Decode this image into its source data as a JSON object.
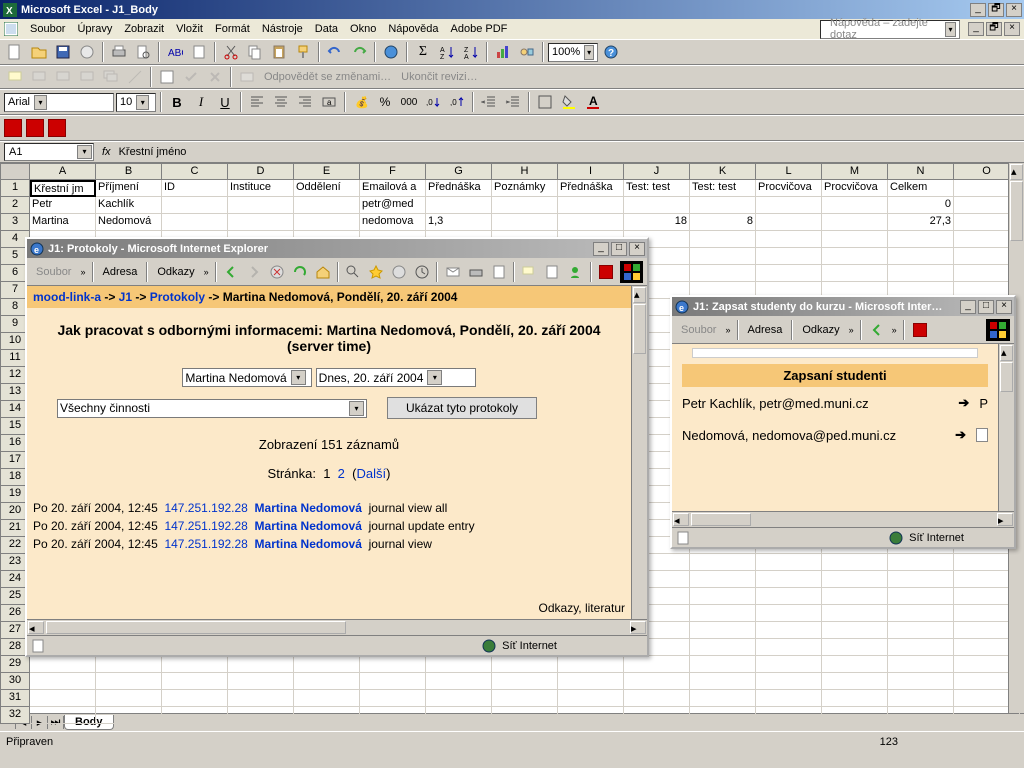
{
  "excel": {
    "app_title": "Microsoft Excel - J1_Body",
    "menus": [
      "Soubor",
      "Úpravy",
      "Zobrazit",
      "Vložit",
      "Formát",
      "Nástroje",
      "Data",
      "Okno",
      "Nápověda",
      "Adobe PDF"
    ],
    "help_placeholder": "Nápověda – zadejte dotaz",
    "track_changes_reply": "Odpovědět se změnami…",
    "track_changes_end": "Ukončit revizi…",
    "zoom": "100%",
    "font_name": "Arial",
    "font_size": "10",
    "name_box": "A1",
    "fx_label": "fx",
    "formula_value": "Křestní jméno",
    "columns": [
      "A",
      "B",
      "C",
      "D",
      "E",
      "F",
      "G",
      "H",
      "I",
      "J",
      "K",
      "L",
      "M",
      "N",
      "O"
    ],
    "rows": [
      "1",
      "2",
      "3",
      "4",
      "5",
      "6",
      "7",
      "8",
      "9",
      "10",
      "11",
      "12",
      "13",
      "14",
      "15",
      "16",
      "17",
      "18",
      "19",
      "20",
      "21",
      "22",
      "23",
      "24",
      "25",
      "26",
      "27",
      "28",
      "29",
      "30",
      "31",
      "32"
    ],
    "data": {
      "r1": [
        "Křestní jm",
        "Příjmení",
        "ID",
        "Instituce",
        "Oddělení",
        "Emailová a",
        "Přednáška",
        "Poznámky",
        "Přednáška",
        "Test: test",
        "Test: test",
        "Procvičova",
        "Procvičova",
        "Celkem",
        ""
      ],
      "r2": [
        "Petr",
        "Kachlík",
        "",
        "",
        "",
        "petr@med",
        "",
        "",
        "",
        "",
        "",
        "",
        "",
        "0",
        ""
      ],
      "r3": [
        "Martina",
        "Nedomová",
        "",
        "",
        "",
        "nedomova",
        "1,3",
        "",
        "",
        "18",
        "8",
        "",
        "",
        "27,3",
        ""
      ]
    },
    "sheet_tab": "Body",
    "status_ready": "Připraven",
    "status_mode": "123"
  },
  "ie1": {
    "title": "J1: Protokoly - Microsoft Internet Explorer",
    "menu_soubor": "Soubor",
    "menu_adresa": "Adresa",
    "menu_odkazy": "Odkazy",
    "breadcrumb_parts": [
      "mood-link-a",
      " -> ",
      "J1",
      " -> ",
      "Protokoly",
      " -> Martina Nedomová, Pondělí, 20. září 2004"
    ],
    "heading": "Jak pracovat s odbornými informacemi: Martina Nedomová, Pondělí, 20. září 2004 (server time)",
    "select_user": "Martina Nedomová",
    "select_date": "Dnes, 20. září 2004",
    "select_activity": "Všechny činnosti",
    "button_show": "Ukázat tyto protokoly",
    "records_text": "Zobrazení 151 záznamů",
    "pager_label": "Stránka:",
    "pager_current": "1",
    "pager_next_page": "2",
    "pager_next_label": "Další",
    "log_entries": [
      {
        "date": "Po  20. září 2004, 12:45",
        "ip": "147.251.192.28",
        "user": "Martina Nedomová",
        "action": "journal view all"
      },
      {
        "date": "Po  20. září 2004, 12:45",
        "ip": "147.251.192.28",
        "user": "Martina Nedomová",
        "action": "journal update entry"
      },
      {
        "date": "Po  20. září 2004, 12:45",
        "ip": "147.251.192.28",
        "user": "Martina Nedomová",
        "action": "journal view"
      }
    ],
    "extra_text": "Odkazy, literatur",
    "status_zone": "Síť Internet"
  },
  "ie2": {
    "title": "J1: Zapsat studenty do kurzu - Microsoft Inter…",
    "menu_soubor": "Soubor",
    "menu_adresa": "Adresa",
    "menu_odkazy": "Odkazy",
    "students_heading": "Zapsaní studenti",
    "students": [
      {
        "name": "Petr Kachlík, petr@med.muni.cz",
        "extra": "P"
      },
      {
        "name": "Nedomová, nedomova@ped.muni.cz",
        "extra": ""
      }
    ],
    "status_zone": "Síť Internet"
  }
}
